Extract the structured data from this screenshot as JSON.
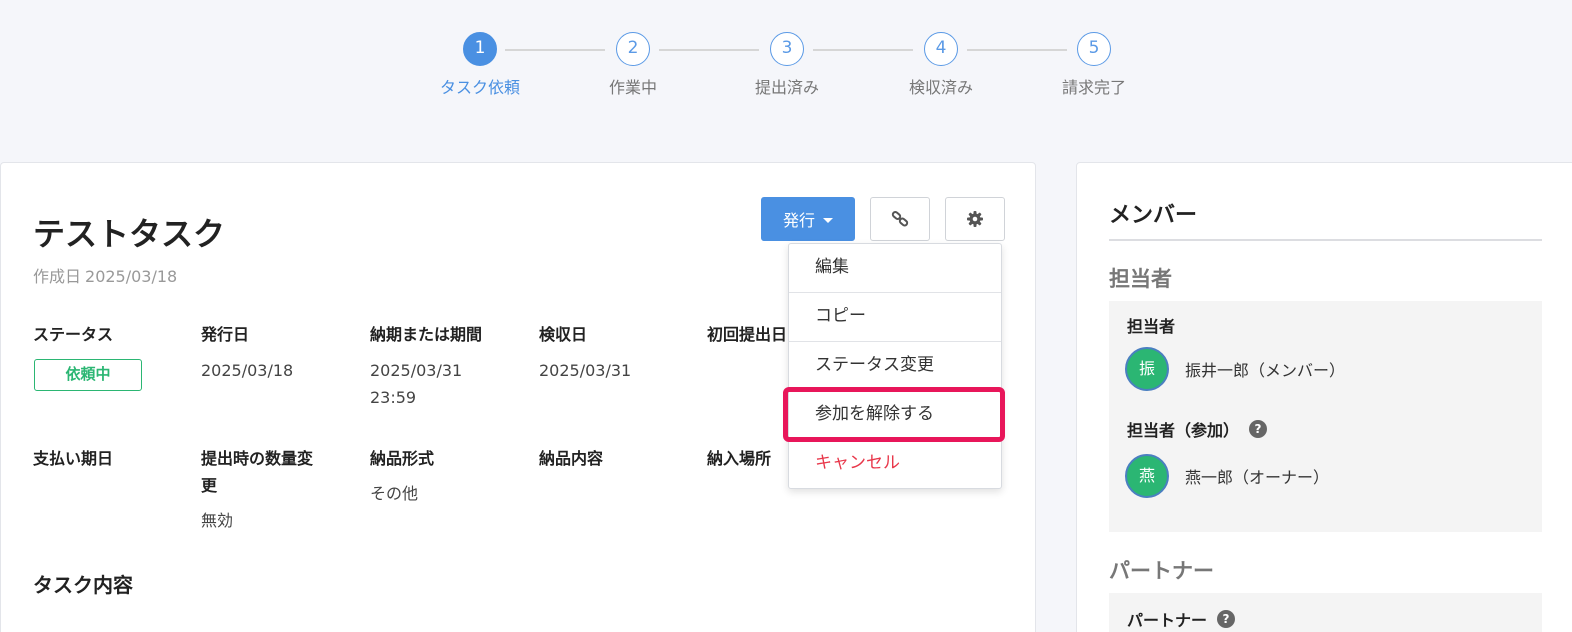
{
  "stepper": {
    "steps": [
      {
        "num": "1",
        "label": "タスク依頼"
      },
      {
        "num": "2",
        "label": "作業中"
      },
      {
        "num": "3",
        "label": "提出済み"
      },
      {
        "num": "4",
        "label": "検収済み"
      },
      {
        "num": "5",
        "label": "請求完了"
      }
    ]
  },
  "task": {
    "title": "テストタスク",
    "created_label": "作成日",
    "created_date": "2025/03/18",
    "issue_button": "発行",
    "link_icon": "link-icon",
    "gear_icon": "gear-icon",
    "fields": {
      "status_label": "ステータス",
      "status_value": "依頼中",
      "issued_label": "発行日",
      "issued_value": "2025/03/18",
      "deadline_label": "納期または期間",
      "deadline_value_1": "2025/03/31",
      "deadline_value_2": "23:59",
      "inspection_label": "検収日",
      "inspection_value": "2025/03/31",
      "first_submit_label": "初回提出日",
      "payment_label": "支払い期日",
      "qty_change_label_1": "提出時の数量変",
      "qty_change_label_2": "更",
      "qty_change_value": "無効",
      "delivery_format_label": "納品形式",
      "delivery_format_value": "その他",
      "delivery_content_label": "納品内容",
      "delivery_place_label": "納入場所"
    },
    "section_title": "タスク内容"
  },
  "dropdown": {
    "items": [
      "編集",
      "コピー",
      "ステータス変更",
      "参加を解除する",
      "キャンセル"
    ]
  },
  "members": {
    "title": "メンバー",
    "assignee_heading": "担当者",
    "assignee_label": "担当者",
    "assignee_avatar": "振",
    "assignee_name": "振井一郎（メンバー）",
    "participant_label": "担当者（参加）",
    "participant_avatar": "燕",
    "participant_name": "燕一郎（オーナー）",
    "partner_heading": "パートナー",
    "partner_label": "パートナー",
    "help_glyph": "?"
  },
  "colors": {
    "accent": "#4a90e2",
    "status_green": "#2bb673",
    "highlight": "#e8165a",
    "cancel_red": "#e8374a"
  }
}
